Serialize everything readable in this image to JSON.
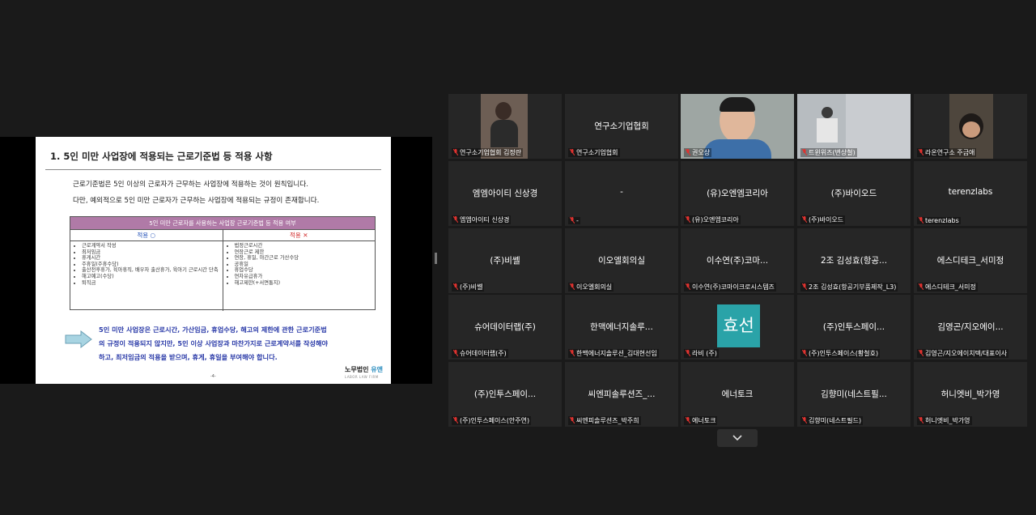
{
  "slide": {
    "title": "1. 5인 미만 사업장에 적용되는 근로기준법 등 적용 사항",
    "para1": "근로기준법은 5인 이상의 근로자가 근무하는 사업장에 적용하는 것이 원칙입니다.",
    "para2": "다만, 예외적으로 5인 미만 근로자가 근무하는 사업장에 적용되는 규정이 존재합니다.",
    "table": {
      "header": "5인 미만 근로자를 사용하는 사업장 근로기준법 등 적용 여부",
      "applied_label": "적용 ○",
      "not_applied_label": "적용 ✕",
      "applied": [
        "근로계약서 작성",
        "최저임금",
        "휴게시간",
        "주휴일(주휴수당)",
        "출산전후휴가, 육아휴직, 배우자 출산휴가, 육아기 근로시간 단축",
        "해고예고(수당)",
        "퇴직금"
      ],
      "not_applied": [
        "법정근로시간",
        "연장근로 제한",
        "연장, 휴일, 야간근로 가산수당",
        "공휴일",
        "휴업수당",
        "연차유급휴가",
        "해고제한(+서면통지)"
      ]
    },
    "summary_lines": [
      "5인 미만 사업장은 근로시간, 가산임금, 휴업수당, 해고의 제한에 관한 근로기준법",
      "의 규정이 적용되지 않지만, 5인 이상 사업장과 마찬가지로 근로계약서를 작성해야",
      "하고, 최저임금의 적용을 받으며, 휴게, 휴일을 부여해야 합니다."
    ],
    "page_number": "-4-",
    "logo_text": "노무법인",
    "logo_accent": "유앤",
    "logo_sub": "LABOR LAW FIRM"
  },
  "participants": [
    {
      "center": "",
      "name": "연구소기업협회 김정란",
      "video": true
    },
    {
      "center": "연구소기업협회",
      "name": "연구소기업협회",
      "video": false
    },
    {
      "center": "",
      "name": "권오상",
      "video": true,
      "active": true
    },
    {
      "center": "",
      "name": "트윈위즈(변상철)",
      "video": true
    },
    {
      "center": "",
      "name": "라온연구소 주금애",
      "video": true
    },
    {
      "center": "엠엠아이티 신상경",
      "name": "엠엠아이티 신상경",
      "video": false
    },
    {
      "center": "-",
      "name": "-",
      "video": false
    },
    {
      "center": "(유)오엔엠코리아",
      "name": "(유)오엔엠코리아",
      "video": false
    },
    {
      "center": "(주)바이오드",
      "name": "(주)바이오드",
      "video": false
    },
    {
      "center": "terenzlabs",
      "name": "terenzlabs",
      "video": false
    },
    {
      "center": "(주)비쎌",
      "name": "(주)비쎌",
      "video": false
    },
    {
      "center": "이오엘회의실",
      "name": "이오엘회의실",
      "video": false
    },
    {
      "center": "이수연(주)코마...",
      "name": "이수연(주)코마이크로시스템즈",
      "video": false
    },
    {
      "center": "2조 김성효(항공...",
      "name": "2조 김성효(항공기부품제작_L3)",
      "video": false
    },
    {
      "center": "에스디테크_서미정",
      "name": "에스디테크_서미정",
      "video": false
    },
    {
      "center": "슈어데이터랩(주)",
      "name": "슈어데이터랩(주)",
      "video": false
    },
    {
      "center": "한맥에너지솔루...",
      "name": "한맥에너지솔루션_김대현선임",
      "video": false
    },
    {
      "center": "",
      "name": "라비 (주)",
      "video": false,
      "avatar": "효선"
    },
    {
      "center": "(주)인투스페이...",
      "name": "(주)인투스페이스(황철호)",
      "video": false
    },
    {
      "center": "김영곤/지오에이...",
      "name": "김영곤/지오에이치텍/대표이사",
      "video": false
    },
    {
      "center": "(주)인투스페이...",
      "name": "(주)인투스페이스(안주연)",
      "video": false
    },
    {
      "center": "씨엔피솔루션즈_...",
      "name": "씨엔피솔루션즈_박주희",
      "video": false
    },
    {
      "center": "에너토크",
      "name": "에너토크",
      "video": false
    },
    {
      "center": "김향미(네스트필...",
      "name": "김향미(네스트필드)",
      "video": false
    },
    {
      "center": "허니엣비_박가영",
      "name": "허니엣비_박가영",
      "video": false
    }
  ],
  "colors": {
    "active_border": "#c6d33a",
    "muted_mic": "#e0322f",
    "avatar_bg": "#2aa3a8"
  },
  "icons": {
    "mic": "muted-mic-icon",
    "scroll": "chevron-down-icon"
  }
}
